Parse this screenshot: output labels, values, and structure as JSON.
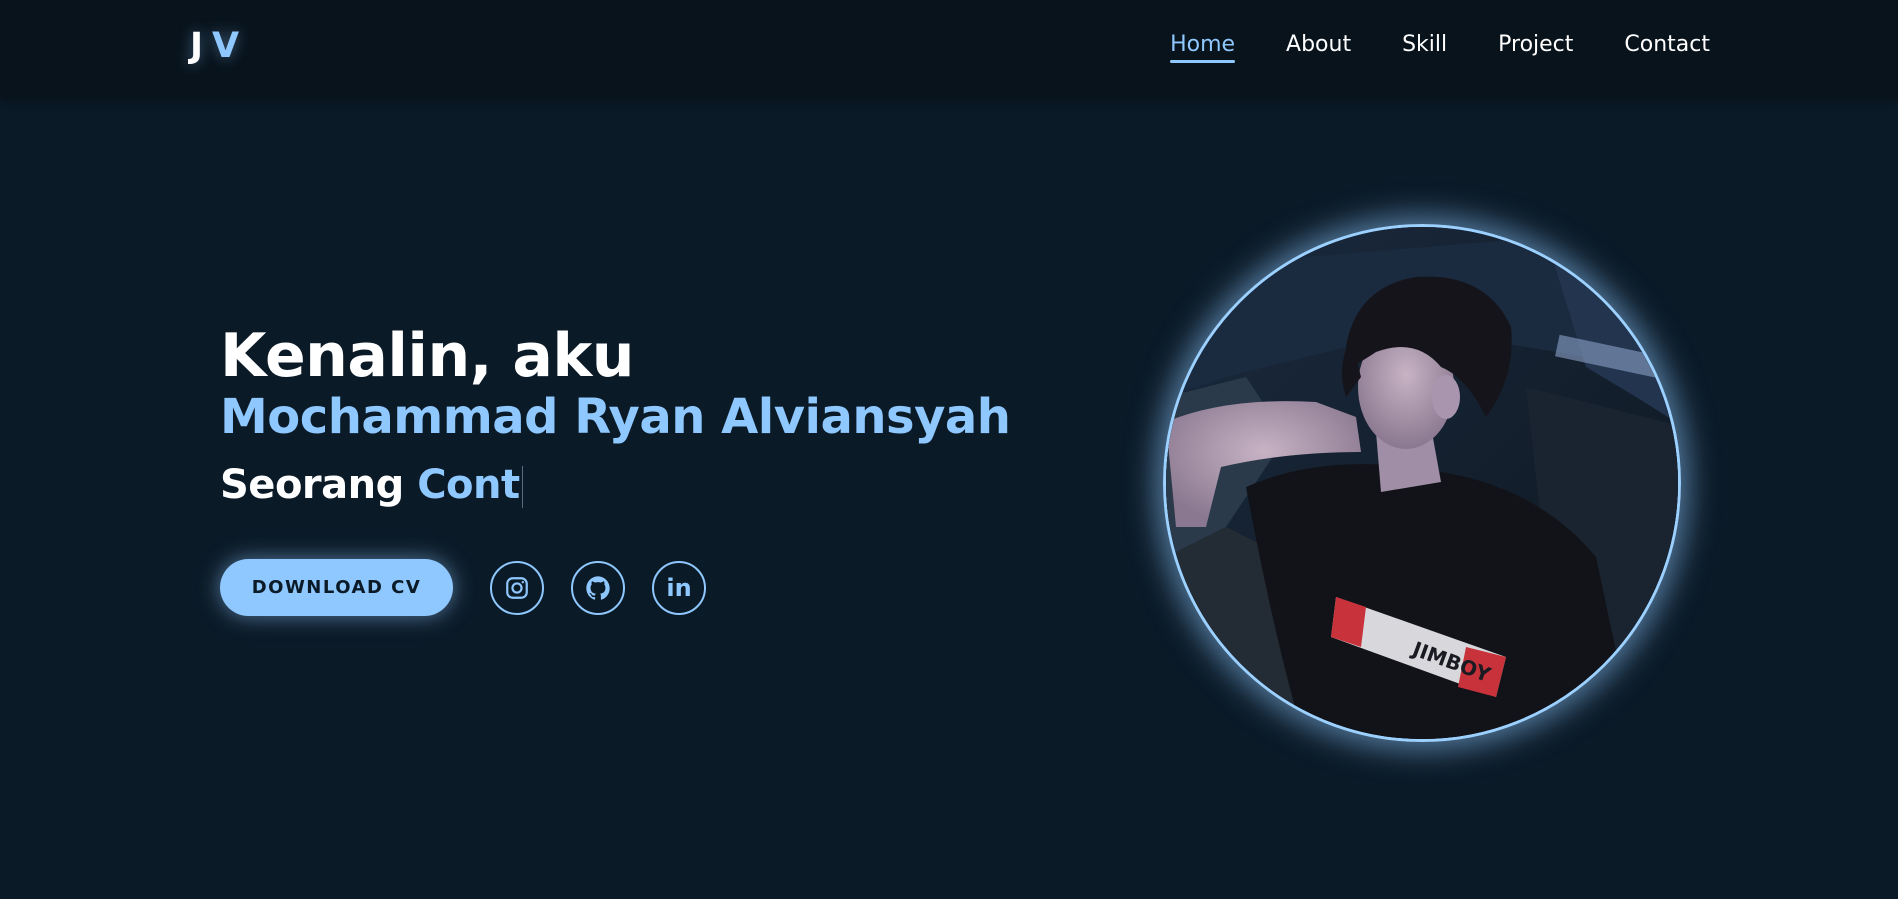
{
  "header": {
    "logo": {
      "first": "J",
      "second": "V"
    },
    "nav": [
      {
        "label": "Home",
        "active": true
      },
      {
        "label": "About",
        "active": false
      },
      {
        "label": "Skill",
        "active": false
      },
      {
        "label": "Project",
        "active": false
      },
      {
        "label": "Contact",
        "active": false
      }
    ]
  },
  "hero": {
    "greeting": "Kenalin, aku",
    "name": "Mochammad Ryan Alviansyah",
    "role_prefix": "Seorang",
    "role_typed": "Cont",
    "download_label": "DOWNLOAD CV",
    "socials": [
      {
        "icon": "instagram-icon"
      },
      {
        "icon": "github-icon"
      },
      {
        "icon": "linkedin-icon",
        "glyph": "in"
      }
    ]
  },
  "profile_photo": {
    "icon": "profile-photo",
    "shirt_text": "JIMBOY"
  },
  "colors": {
    "background": "#0b1a27",
    "navbar": "#08131c",
    "accent": "#8fc8ff",
    "text": "#ffffff"
  }
}
